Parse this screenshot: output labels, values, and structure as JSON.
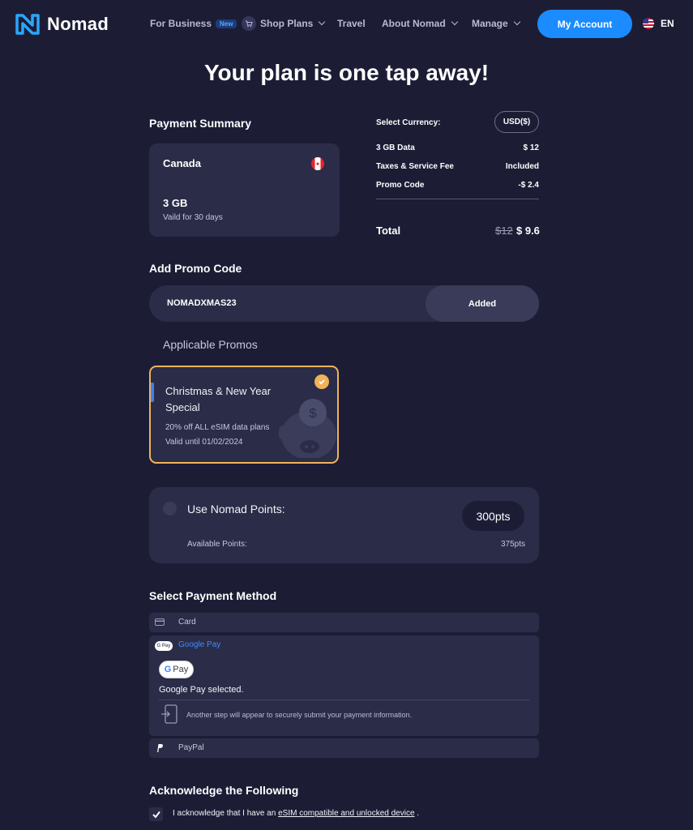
{
  "nav": {
    "brand": "Nomad",
    "for_business": "For Business",
    "new_badge": "New",
    "shop_plans": "Shop Plans",
    "travel": "Travel",
    "about": "About Nomad",
    "manage": "Manage",
    "my_account": "My Account",
    "language": "EN"
  },
  "page_title": "Your plan is one tap away!",
  "summary": {
    "title": "Payment Summary",
    "plan": {
      "country": "Canada",
      "data": "3 GB",
      "validity": "Vaild for 30 days"
    },
    "currency_label": "Select Currency:",
    "currency": "USD($)",
    "lines": [
      {
        "label": "3 GB Data",
        "value": "$ 12"
      },
      {
        "label": "Taxes & Service Fee",
        "value": "Included"
      },
      {
        "label": "Promo Code",
        "value": "-$ 2.4"
      }
    ],
    "total_label": "Total",
    "total_old": "$12",
    "total_new": "$ 9.6"
  },
  "promo": {
    "title": "Add Promo Code",
    "code": "NOMADXMAS23",
    "status": "Added",
    "applicable_title": "Applicable Promos",
    "card": {
      "title": "Christmas & New Year Special",
      "description": "20% off ALL eSIM data plans",
      "validity": "Valid until 01/02/2024"
    }
  },
  "points": {
    "label": "Use Nomad Points:",
    "value": "300pts",
    "available_label": "Available Points:",
    "available_value": "375pts"
  },
  "payment": {
    "title": "Select Payment Method",
    "card_label": "Card",
    "gpay_label": "Google Pay",
    "gpay_chip": "G Pay",
    "gpay_button": "Pay",
    "gpay_selected": "Google Pay selected.",
    "gpay_info": "Another step will appear to securely submit your payment information.",
    "paypal_label": "PayPal"
  },
  "acknowledge": {
    "title": "Acknowledge the Following",
    "text_before": "I acknowledge that I have an ",
    "link": "eSIM compatible and unlocked device",
    "text_after": " ."
  },
  "colors": {
    "background": "#1c1d35",
    "card": "#2b2c48",
    "accent": "#1a8cff",
    "promo_border": "#f1b25a"
  }
}
